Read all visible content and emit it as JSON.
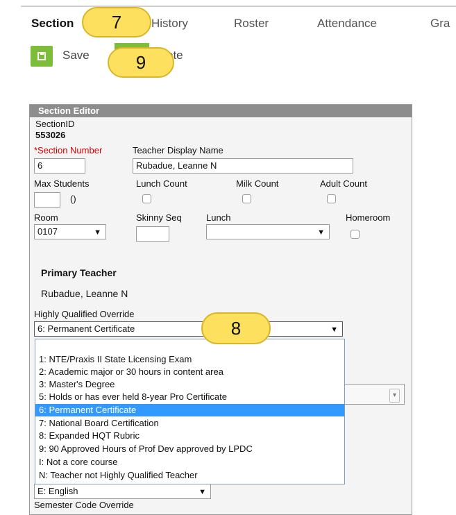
{
  "tabs": {
    "section": "Section",
    "history": "History",
    "roster": "Roster",
    "attendance": "Attendance",
    "grades": "Gra"
  },
  "toolbar": {
    "save_label": "Save",
    "partial_label": "ete"
  },
  "callouts": {
    "c7": "7",
    "c9": "9",
    "c8": "8"
  },
  "editor": {
    "title": "Section Editor",
    "section_id_label": "SectionID",
    "section_id_value": "553026",
    "section_number_label": "*Section Number",
    "section_number_value": "6",
    "teacher_display_label": "Teacher Display Name",
    "teacher_display_value": "Rubadue, Leanne N",
    "max_students_label": "Max Students",
    "max_students_extra": "()",
    "lunch_count_label": "Lunch Count",
    "milk_count_label": "Milk Count",
    "adult_count_label": "Adult Count",
    "room_label": "Room",
    "room_value": "0107",
    "skinny_seq_label": "Skinny Seq",
    "lunch_label": "Lunch",
    "homeroom_label": "Homeroom",
    "primary_teacher_heading": "Primary Teacher",
    "primary_teacher_name": "Rubadue, Leanne N",
    "hq_override_label": "Highly Qualified Override",
    "hq_override_value": "6: Permanent Certificate",
    "hq_options": [
      "1: NTE/Praxis II State Licensing Exam",
      "2: Academic major or 30 hours in content area",
      "3: Master's Degree",
      "5: Holds or has ever held 8-year Pro Certificate",
      "6: Permanent Certificate",
      "7: National Board Certification",
      "8: Expanded HQT Rubric",
      "9: 90 Approved Hours of Prof Dev approved by LPDC",
      "I: Not a core course",
      "N: Teacher not Highly Qualified Teacher"
    ],
    "language_value": "E: English",
    "semester_override_label": "Semester Code Override"
  }
}
